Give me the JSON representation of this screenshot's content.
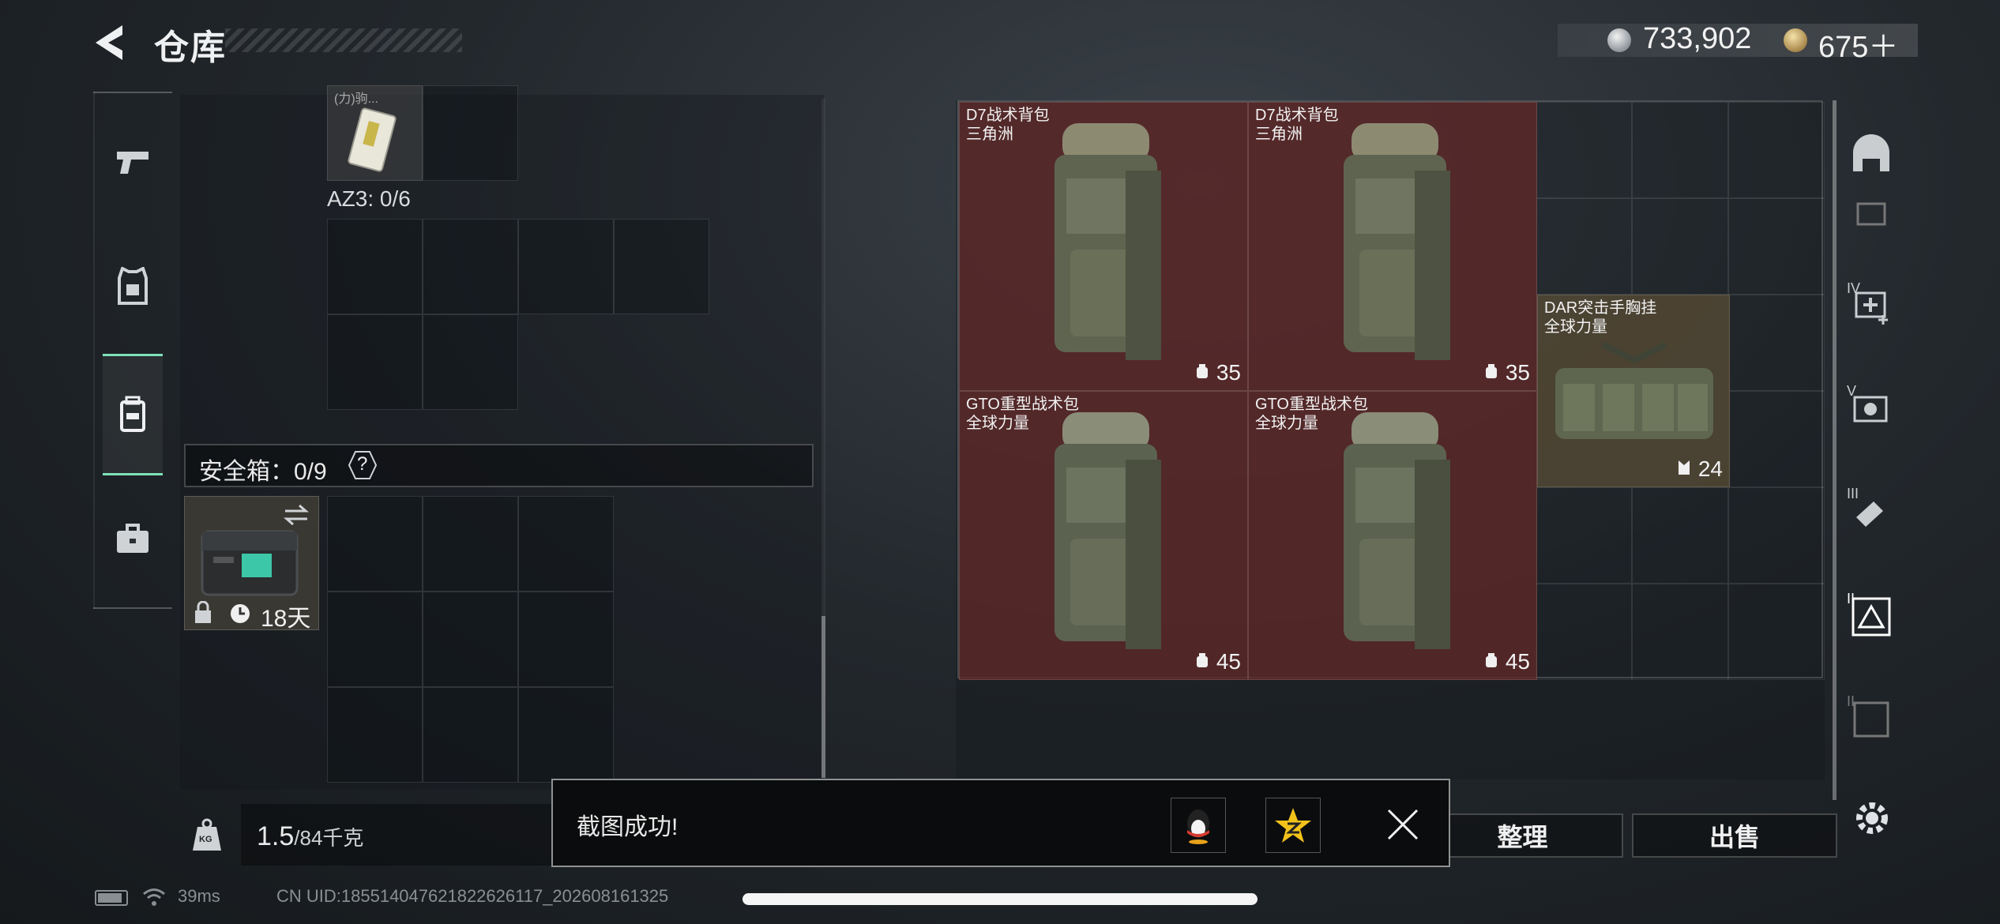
{
  "header": {
    "title": "仓库",
    "currency": [
      {
        "icon": "silver-coin-icon",
        "value": "733,902"
      },
      {
        "icon": "gold-coin-icon",
        "value": "675＋"
      }
    ]
  },
  "left_rail": {
    "items": [
      {
        "icon": "pistol-icon",
        "active": false
      },
      {
        "icon": "armor-vest-icon",
        "active": false
      },
      {
        "icon": "backpack-icon",
        "active": true
      },
      {
        "icon": "briefcase-icon",
        "active": false
      }
    ]
  },
  "left_panel": {
    "partial_item_label": "(力)驹...",
    "az_label": "AZ3: 0/6",
    "safebox_label": "安全箱：0/9",
    "help_glyph": "?",
    "safebox_days": "18天"
  },
  "weight": {
    "current": "1.5",
    "max": "/84千克",
    "kg_badge": "KG"
  },
  "grid_items": [
    {
      "name_line1": "D7战术背包",
      "name_line2": "三角洲",
      "count": "35",
      "count_icon": "backpack-capacity-icon"
    },
    {
      "name_line1": "D7战术背包",
      "name_line2": "三角洲",
      "count": "35",
      "count_icon": "backpack-capacity-icon"
    },
    {
      "name_line1": "DAR突击手胸挂",
      "name_line2": "全球力量",
      "count": "24",
      "count_icon": "chest-rig-capacity-icon"
    },
    {
      "name_line1": "GTO重型战术包",
      "name_line2": "全球力量",
      "count": "45",
      "count_icon": "backpack-capacity-icon"
    },
    {
      "name_line1": "GTO重型战术包",
      "name_line2": "全球力量",
      "count": "45",
      "count_icon": "backpack-capacity-icon"
    }
  ],
  "filter_rail": [
    {
      "icon": "helmet-filter-icon",
      "label": ""
    },
    {
      "icon": "medkit-filter-icon",
      "label": "IV"
    },
    {
      "icon": "camera-filter-icon",
      "label": "V"
    },
    {
      "icon": "tool-filter-icon",
      "label": "III"
    },
    {
      "icon": "triangle-box-filter-icon",
      "label": "II"
    },
    {
      "icon": "container-filter-icon",
      "label": "II"
    }
  ],
  "buttons": {
    "sort": "整理",
    "sell": "出售"
  },
  "toast": {
    "message": "截图成功!"
  },
  "status_bar": {
    "ping": "39ms",
    "uid": "CN UID:1855140476218226261​17_202608161325"
  },
  "colors": {
    "accent_green": "#7fe0b8",
    "item_red_bg": "#5f2828",
    "item_olive_bg": "#524834"
  }
}
